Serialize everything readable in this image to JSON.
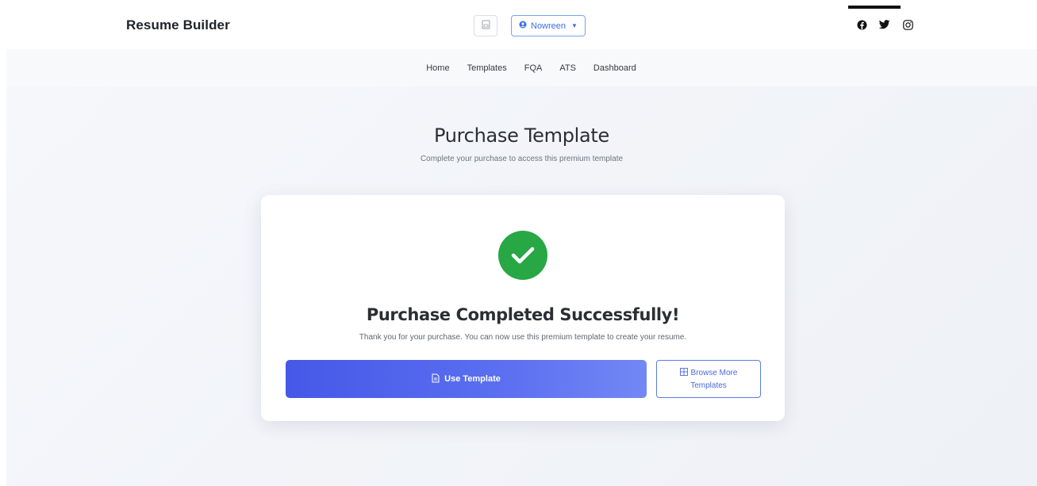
{
  "header": {
    "brand": "Resume Builder",
    "user_label": "Nowreen",
    "icons": [
      "save-icon",
      "user-circle-icon",
      "chevron-down-icon"
    ]
  },
  "socials": [
    "facebook-icon",
    "twitter-icon",
    "instagram-icon"
  ],
  "nav": {
    "items": [
      "Home",
      "Templates",
      "FQA",
      "ATS",
      "Dashboard"
    ]
  },
  "page": {
    "title": "Purchase Template",
    "subtitle": "Complete your purchase to access this premium template"
  },
  "card": {
    "success_title": "Purchase Completed Successfully!",
    "success_message": "Thank you for your purchase. You can now use this premium template to create your resume.",
    "use_template_label": "Use Template",
    "browse_line1": "Browse More",
    "browse_line2": "Templates"
  },
  "colors": {
    "accent": "#4558e8",
    "success": "#28a745",
    "link": "#3b6fe0"
  }
}
